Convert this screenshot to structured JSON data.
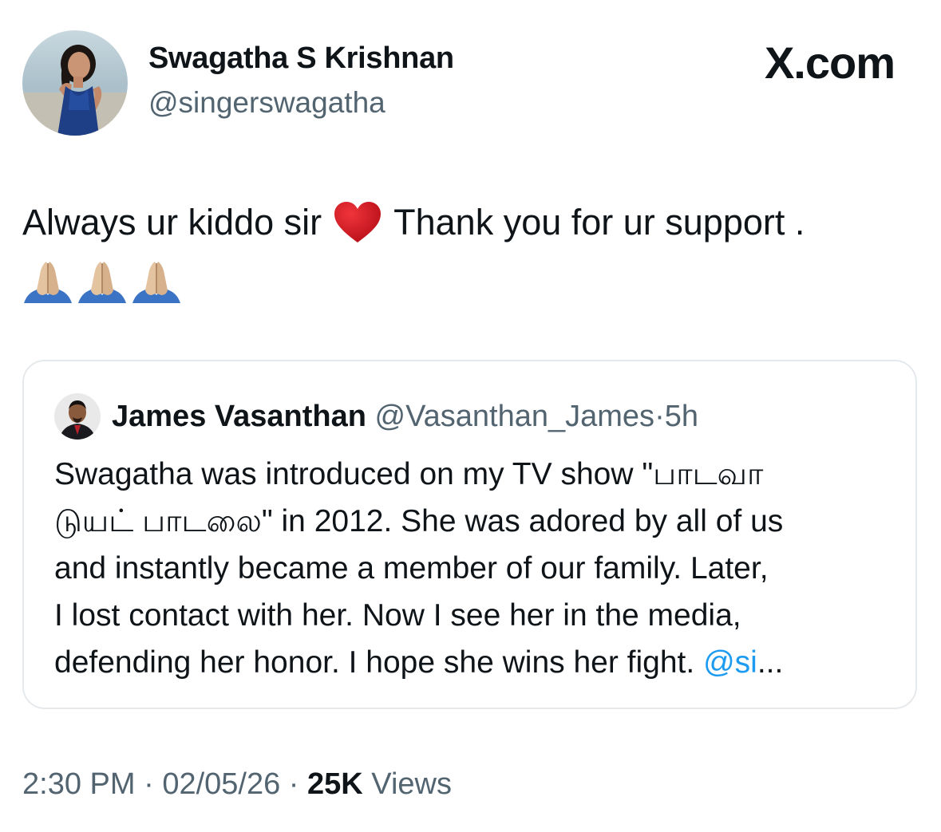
{
  "author": {
    "display_name": "Swagatha S Krishnan",
    "handle": "@singerswagatha",
    "avatar_icon": "profile-photo"
  },
  "brand": {
    "label": "X.com"
  },
  "tweet": {
    "text_part1": "Always ur kiddo sir",
    "emoji_heart": "red-heart-icon",
    "text_part2": "Thank you for ur support .",
    "emoji_pray": "folded-hands-icon",
    "emoji_pray_count": 3
  },
  "quoted": {
    "display_name": "James Vasanthan",
    "handle": "@Vasanthan_James",
    "separator": "·",
    "time": "5h",
    "lines": [
      "Swagatha was introduced on my TV show \"பாடவா",
      "டுயட் பாடலை\" in 2012. She was adored by all of us",
      "and instantly became a member of our family. Later,",
      "I lost contact with her. Now I see her in the media,"
    ],
    "last_line_text": "defending her honor. I hope she wins her fight. ",
    "last_line_mention": "@si",
    "last_line_ellipsis": "..."
  },
  "meta": {
    "time": "2:30 PM",
    "sep1": " · ",
    "date": "02/05/26",
    "sep2": " · ",
    "views_count": "25K",
    "views_label": " Views"
  },
  "colors": {
    "text_primary": "#0f1419",
    "text_secondary": "#536471",
    "link": "#1d9bf0",
    "card_border": "#e6e9ec"
  }
}
